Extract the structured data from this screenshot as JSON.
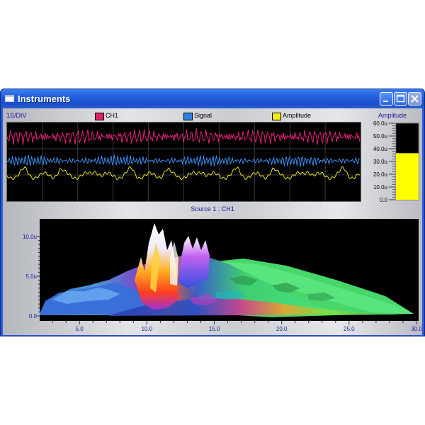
{
  "window": {
    "title": "Instruments",
    "icon": "window-app-icon",
    "controls": [
      "minimize-icon",
      "maximize-icon",
      "close-icon"
    ]
  },
  "oscilloscope": {
    "time_div": "1S/DIV",
    "legend": [
      {
        "label": "CH1",
        "color": "#e0206a"
      },
      {
        "label": "Signal",
        "color": "#2a7fe0"
      },
      {
        "label": "Amplitude",
        "color": "#f0f000"
      }
    ],
    "trace_colors": {
      "ch1": "#e8207a",
      "signal": "#3a8ff0",
      "amplitude": "#e8e020"
    }
  },
  "amplitude_meter": {
    "title": "Amplitude",
    "ticks": [
      "60.0u",
      "50.0u",
      "40.0u",
      "30.0u",
      "20.0u",
      "10.0u",
      "0.0"
    ],
    "level": 36.5,
    "max": 60,
    "bar_color": "#ffff00"
  },
  "spectrum": {
    "title": "Source 1 : CH1",
    "y_ticks": [
      "10.0u",
      "5.0u",
      "0.0"
    ],
    "x_ticks": [
      "5.0",
      "10.0",
      "15.0",
      "20.0",
      "25.0",
      "30.0"
    ]
  }
}
